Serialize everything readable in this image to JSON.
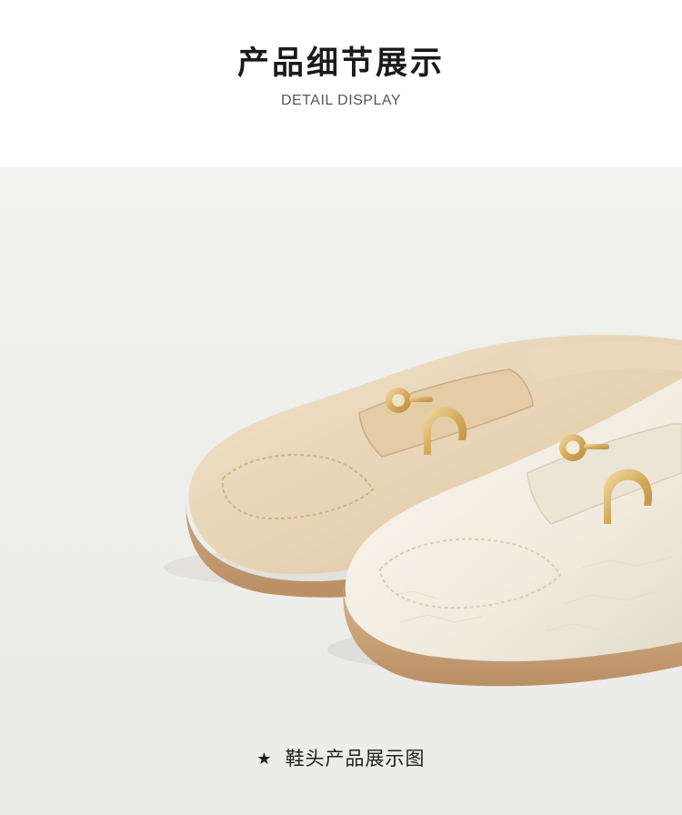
{
  "header": {
    "title": "产品细节展示",
    "subtitle": "DETAIL DISPLAY"
  },
  "photo": {
    "subject": "two-loafers-toe-closeup",
    "colors": {
      "background": "#eeeeec",
      "beige_shoe": "#e8d5b7",
      "cream_shoe": "#f3eee2",
      "sole": "#c9a47f",
      "hardware": "#d8b36a"
    }
  },
  "caption": {
    "star": "★",
    "text": "鞋头产品展示图"
  }
}
